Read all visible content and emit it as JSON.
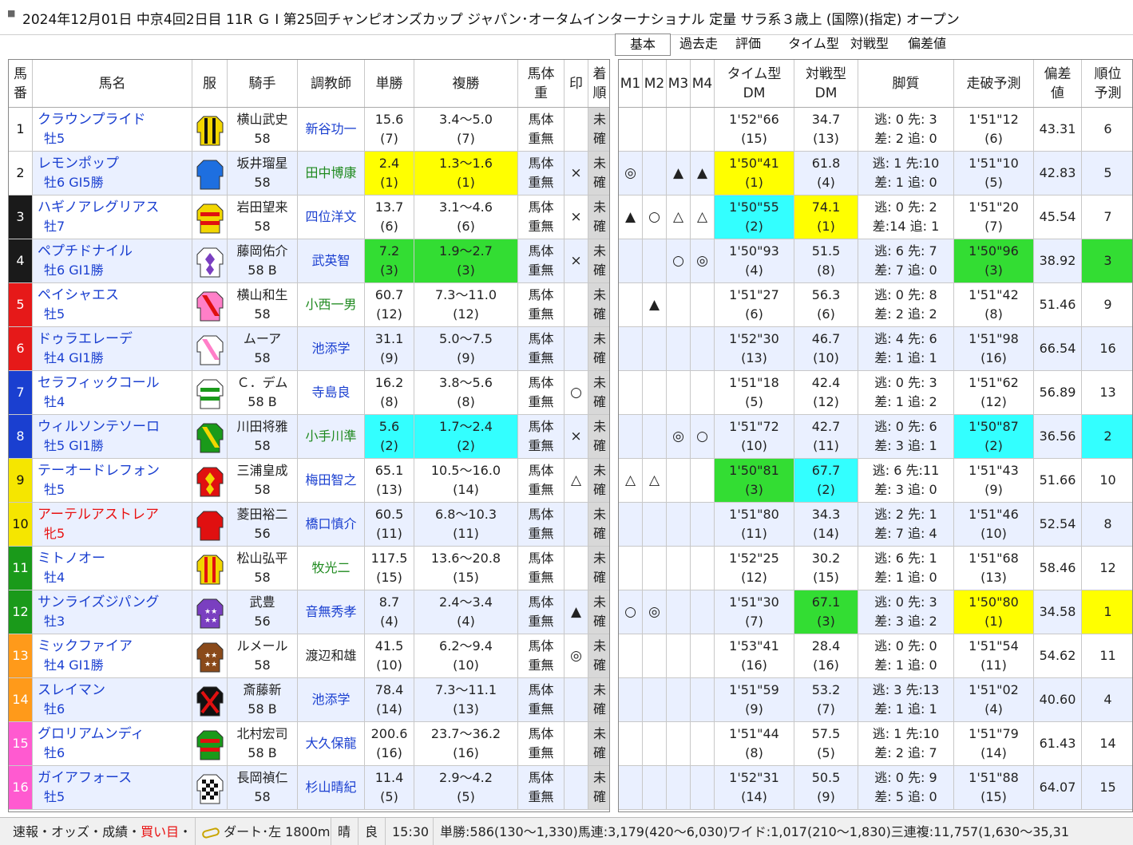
{
  "title": "2024年12月01日 中京4回2日目 11R Ｇ Ⅰ 第25回チャンピオンズカップ ジャパン･オータムインターナショナル 定量 サラ系３歳上 (国際)(指定) オープン",
  "tabs": [
    "基本",
    "過去走",
    "評価",
    "タイム型",
    "対戦型",
    "偏差値"
  ],
  "left_headers": {
    "num": [
      "馬",
      "番"
    ],
    "name": "馬名",
    "silk": "服",
    "jockey": "騎手",
    "trainer": "調教師",
    "win": "単勝",
    "place": "複勝",
    "weight": [
      "馬体",
      "重"
    ],
    "mark": "印",
    "finish": [
      "着",
      "順"
    ]
  },
  "right_headers": {
    "m1": "M1",
    "m2": "M2",
    "m3": "M3",
    "m4": "M4",
    "time": [
      "タイム型",
      "DM"
    ],
    "vs": [
      "対戦型",
      "DM"
    ],
    "style": "脚質",
    "pred": "走破予測",
    "dev": [
      "偏差",
      "値"
    ],
    "rank": [
      "順位",
      "予測"
    ]
  },
  "weight_text": [
    "馬体",
    "重無"
  ],
  "unfixed_text": [
    "未",
    "確"
  ],
  "horses": [
    {
      "num": "1",
      "name": "クラウンプライド",
      "sub": "牡5",
      "jockey": "横山武史",
      "kinryo": "58",
      "trainer": "新谷功一",
      "tcolor": "B",
      "win": "15.6",
      "win_rank": "(7)",
      "place": "3.4～5.0",
      "place_rank": "(7)",
      "mark": "",
      "m": [
        "",
        "",
        "",
        ""
      ],
      "tdm": "1'52\"66",
      "tdm_r": "(15)",
      "vdm": "34.7",
      "vdm_r": "(13)",
      "style1": "逃: 0 先: 3",
      "style2": "差: 2 追: 0",
      "pred": "1'51\"12",
      "pred_r": "(6)",
      "dev": "43.31",
      "rank": "6"
    },
    {
      "num": "2",
      "name": "レモンポップ",
      "sub": "牡6 GI5勝",
      "jockey": "坂井瑠星",
      "kinryo": "58",
      "trainer": "田中博康",
      "tcolor": "G",
      "win": "2.4",
      "win_rank": "(1)",
      "place": "1.3～1.6",
      "place_rank": "(1)",
      "mark": "×",
      "m": [
        "◎",
        "",
        "▲",
        "▲"
      ],
      "tdm": "1'50\"41",
      "tdm_r": "(1)",
      "vdm": "61.8",
      "vdm_r": "(4)",
      "style1": "逃: 1 先:10",
      "style2": "差: 1 追: 0",
      "pred": "1'51\"10",
      "pred_r": "(5)",
      "dev": "42.83",
      "rank": "5"
    },
    {
      "num": "3",
      "name": "ハギノアレグリアス",
      "sub": "牡7",
      "jockey": "岩田望来",
      "kinryo": "58",
      "trainer": "四位洋文",
      "tcolor": "B",
      "win": "13.7",
      "win_rank": "(6)",
      "place": "3.1～4.6",
      "place_rank": "(6)",
      "mark": "×",
      "m": [
        "▲",
        "○",
        "△",
        "△"
      ],
      "tdm": "1'50\"55",
      "tdm_r": "(2)",
      "vdm": "74.1",
      "vdm_r": "(1)",
      "style1": "逃: 0 先: 2",
      "style2": "差:14 追: 1",
      "pred": "1'51\"20",
      "pred_r": "(7)",
      "dev": "45.54",
      "rank": "7"
    },
    {
      "num": "4",
      "name": "ペプチドナイル",
      "sub": "牡6 GI1勝",
      "jockey": "藤岡佑介",
      "kinryo": "58 B",
      "trainer": "武英智",
      "tcolor": "B",
      "win": "7.2",
      "win_rank": "(3)",
      "place": "1.9～2.7",
      "place_rank": "(3)",
      "mark": "×",
      "m": [
        "",
        "",
        "○",
        "◎"
      ],
      "tdm": "1'50\"93",
      "tdm_r": "(4)",
      "vdm": "51.5",
      "vdm_r": "(8)",
      "style1": "逃: 6 先: 7",
      "style2": "差: 7 追: 0",
      "pred": "1'50\"96",
      "pred_r": "(3)",
      "dev": "38.92",
      "rank": "3"
    },
    {
      "num": "5",
      "name": "ペイシャエス",
      "sub": "牡5",
      "jockey": "横山和生",
      "kinryo": "58",
      "trainer": "小西一男",
      "tcolor": "G",
      "win": "60.7",
      "win_rank": "(12)",
      "place": "7.3～11.0",
      "place_rank": "(12)",
      "mark": "",
      "m": [
        "",
        "▲",
        "",
        ""
      ],
      "tdm": "1'51\"27",
      "tdm_r": "(6)",
      "vdm": "56.3",
      "vdm_r": "(6)",
      "style1": "逃: 0 先: 8",
      "style2": "差: 2 追: 2",
      "pred": "1'51\"42",
      "pred_r": "(8)",
      "dev": "51.46",
      "rank": "9"
    },
    {
      "num": "6",
      "name": "ドゥラエレーデ",
      "sub": "牡4 GI1勝",
      "jockey": "ムーア",
      "kinryo": "58",
      "trainer": "池添学",
      "tcolor": "B",
      "win": "31.1",
      "win_rank": "(9)",
      "place": "5.0～7.5",
      "place_rank": "(9)",
      "mark": "",
      "m": [
        "",
        "",
        "",
        ""
      ],
      "tdm": "1'52\"30",
      "tdm_r": "(13)",
      "vdm": "46.7",
      "vdm_r": "(10)",
      "style1": "逃: 4 先: 6",
      "style2": "差: 1 追: 1",
      "pred": "1'51\"98",
      "pred_r": "(16)",
      "dev": "66.54",
      "rank": "16"
    },
    {
      "num": "7",
      "name": "セラフィックコール",
      "sub": "牡4",
      "jockey": "Ｃ．デム",
      "kinryo": "58 B",
      "trainer": "寺島良",
      "tcolor": "B",
      "win": "16.2",
      "win_rank": "(8)",
      "place": "3.8～5.6",
      "place_rank": "(8)",
      "mark": "○",
      "m": [
        "",
        "",
        "",
        ""
      ],
      "tdm": "1'51\"18",
      "tdm_r": "(5)",
      "vdm": "42.4",
      "vdm_r": "(12)",
      "style1": "逃: 0 先: 3",
      "style2": "差: 1 追: 2",
      "pred": "1'51\"62",
      "pred_r": "(12)",
      "dev": "56.89",
      "rank": "13"
    },
    {
      "num": "8",
      "name": "ウィルソンテソーロ",
      "sub": "牡5 GI1勝",
      "jockey": "川田将雅",
      "kinryo": "58",
      "trainer": "小手川準",
      "tcolor": "G",
      "win": "5.6",
      "win_rank": "(2)",
      "place": "1.7～2.4",
      "place_rank": "(2)",
      "mark": "×",
      "m": [
        "",
        "",
        "◎",
        "○"
      ],
      "tdm": "1'51\"72",
      "tdm_r": "(10)",
      "vdm": "42.7",
      "vdm_r": "(11)",
      "style1": "逃: 0 先: 6",
      "style2": "差: 3 追: 1",
      "pred": "1'50\"87",
      "pred_r": "(2)",
      "dev": "36.56",
      "rank": "2"
    },
    {
      "num": "9",
      "name": "テーオードレフォン",
      "sub": "牡5",
      "jockey": "三浦皇成",
      "kinryo": "58",
      "trainer": "梅田智之",
      "tcolor": "B",
      "win": "65.1",
      "win_rank": "(13)",
      "place": "10.5～16.0",
      "place_rank": "(14)",
      "mark": "△",
      "m": [
        "△",
        "△",
        "",
        ""
      ],
      "tdm": "1'50\"81",
      "tdm_r": "(3)",
      "vdm": "67.7",
      "vdm_r": "(2)",
      "style1": "逃: 6 先:11",
      "style2": "差: 3 追: 0",
      "pred": "1'51\"43",
      "pred_r": "(9)",
      "dev": "51.66",
      "rank": "10"
    },
    {
      "num": "10",
      "name": "アーテルアストレア",
      "sub": "牝5",
      "fem": true,
      "jockey": "菱田裕二",
      "kinryo": "56",
      "trainer": "橋口慎介",
      "tcolor": "B",
      "win": "60.5",
      "win_rank": "(11)",
      "place": "6.8～10.3",
      "place_rank": "(11)",
      "mark": "",
      "m": [
        "",
        "",
        "",
        ""
      ],
      "tdm": "1'51\"80",
      "tdm_r": "(11)",
      "vdm": "34.3",
      "vdm_r": "(14)",
      "style1": "逃: 2 先: 1",
      "style2": "差: 7 追: 4",
      "pred": "1'51\"46",
      "pred_r": "(10)",
      "dev": "52.54",
      "rank": "8"
    },
    {
      "num": "11",
      "name": "ミトノオー",
      "sub": "牡4",
      "jockey": "松山弘平",
      "kinryo": "58",
      "trainer": "牧光二",
      "tcolor": "G",
      "win": "117.5",
      "win_rank": "(15)",
      "place": "13.6～20.8",
      "place_rank": "(15)",
      "mark": "",
      "m": [
        "",
        "",
        "",
        ""
      ],
      "tdm": "1'52\"25",
      "tdm_r": "(12)",
      "vdm": "30.2",
      "vdm_r": "(15)",
      "style1": "逃: 6 先: 1",
      "style2": "差: 1 追: 0",
      "pred": "1'51\"68",
      "pred_r": "(13)",
      "dev": "58.46",
      "rank": "12"
    },
    {
      "num": "12",
      "name": "サンライズジパング",
      "sub": "牡3",
      "jockey": "武豊",
      "kinryo": "56",
      "trainer": "音無秀孝",
      "tcolor": "B",
      "win": "8.7",
      "win_rank": "(4)",
      "place": "2.4～3.4",
      "place_rank": "(4)",
      "mark": "▲",
      "m": [
        "○",
        "◎",
        "",
        ""
      ],
      "tdm": "1'51\"30",
      "tdm_r": "(7)",
      "vdm": "67.1",
      "vdm_r": "(3)",
      "style1": "逃: 0 先: 3",
      "style2": "差: 3 追: 2",
      "pred": "1'50\"80",
      "pred_r": "(1)",
      "dev": "34.58",
      "rank": "1"
    },
    {
      "num": "13",
      "name": "ミックファイア",
      "sub": "牡4 GI1勝",
      "jockey": "ルメール",
      "kinryo": "58",
      "trainer": "渡辺和雄",
      "tcolor": "K",
      "win": "41.5",
      "win_rank": "(10)",
      "place": "6.2～9.4",
      "place_rank": "(10)",
      "mark": "◎",
      "m": [
        "",
        "",
        "",
        ""
      ],
      "tdm": "1'53\"41",
      "tdm_r": "(16)",
      "vdm": "28.4",
      "vdm_r": "(16)",
      "style1": "逃: 0 先: 0",
      "style2": "差: 1 追: 0",
      "pred": "1'51\"54",
      "pred_r": "(11)",
      "dev": "54.62",
      "rank": "11"
    },
    {
      "num": "14",
      "name": "スレイマン",
      "sub": "牡6",
      "jockey": "斎藤新",
      "kinryo": "58 B",
      "trainer": "池添学",
      "tcolor": "B",
      "win": "78.4",
      "win_rank": "(14)",
      "place": "7.3～11.1",
      "place_rank": "(13)",
      "mark": "",
      "m": [
        "",
        "",
        "",
        ""
      ],
      "tdm": "1'51\"59",
      "tdm_r": "(9)",
      "vdm": "53.2",
      "vdm_r": "(7)",
      "style1": "逃: 3 先:13",
      "style2": "差: 1 追: 1",
      "pred": "1'51\"02",
      "pred_r": "(4)",
      "dev": "40.60",
      "rank": "4"
    },
    {
      "num": "15",
      "name": "グロリアムンディ",
      "sub": "牡6",
      "jockey": "北村宏司",
      "kinryo": "58 B",
      "trainer": "大久保龍",
      "tcolor": "B",
      "win": "200.6",
      "win_rank": "(16)",
      "place": "23.7～36.2",
      "place_rank": "(16)",
      "mark": "",
      "m": [
        "",
        "",
        "",
        ""
      ],
      "tdm": "1'51\"44",
      "tdm_r": "(8)",
      "vdm": "57.5",
      "vdm_r": "(5)",
      "style1": "逃: 1 先:10",
      "style2": "差: 2 追: 7",
      "pred": "1'51\"79",
      "pred_r": "(14)",
      "dev": "61.43",
      "rank": "14"
    },
    {
      "num": "16",
      "name": "ガイアフォース",
      "sub": "牡5",
      "jockey": "長岡禎仁",
      "kinryo": "58",
      "trainer": "杉山晴紀",
      "tcolor": "B",
      "win": "11.4",
      "win_rank": "(5)",
      "place": "2.9～4.2",
      "place_rank": "(5)",
      "mark": "",
      "m": [
        "",
        "",
        "",
        ""
      ],
      "tdm": "1'52\"31",
      "tdm_r": "(14)",
      "vdm": "50.5",
      "vdm_r": "(9)",
      "style1": "逃: 0 先: 9",
      "style2": "差: 5 追: 0",
      "pred": "1'51\"88",
      "pred_r": "(15)",
      "dev": "64.07",
      "rank": "15"
    }
  ],
  "frame_colors": [
    "#ffffff",
    "#ffffff",
    "#1a1a1a",
    "#1a1a1a",
    "#e61919",
    "#e61919",
    "#1a3fd0",
    "#1a3fd0",
    "#f5e600",
    "#f5e600",
    "#1a9a1a",
    "#1a9a1a",
    "#ff9a1a",
    "#ff9a1a",
    "#ff5ad0",
    "#ff5ad0"
  ],
  "highlight_colors": {
    "yellow": "#ffff00",
    "green": "#33dd33",
    "cyan": "#33ffff"
  },
  "status": {
    "links": [
      "速報",
      "オッズ",
      "成績",
      "買い目"
    ],
    "course": "ダート･左 1800m",
    "weather": "晴",
    "going": "良",
    "time": "15:30",
    "payout": "単勝:586(130～1,330)馬連:3,179(420～6,030)ワイド:1,017(210～1,830)三連複:11,757(1,630～35,310)"
  }
}
